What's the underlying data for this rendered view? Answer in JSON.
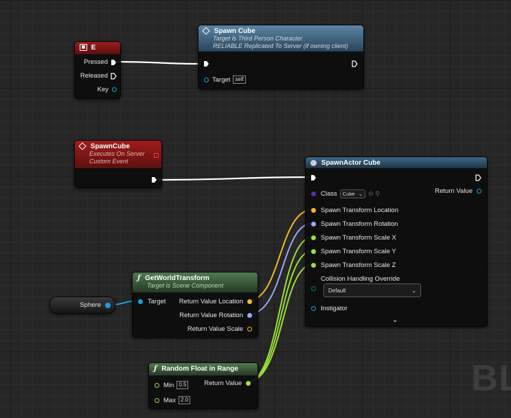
{
  "nodes": {
    "e_key": {
      "title": "E",
      "pressed": "Pressed",
      "released": "Released",
      "key": "Key"
    },
    "spawn_cube_call": {
      "title": "Spawn Cube",
      "subtitle1": "Target is Third Person Character",
      "subtitle2": "RELIABLE Replicated To Server (if owning client)",
      "target_label": "Target",
      "target_value": "self"
    },
    "spawn_cube_event": {
      "title": "SpawnCube",
      "subtitle1": "Executes On Server",
      "subtitle2": "Custom Event"
    },
    "spawn_actor": {
      "title": "SpawnActor Cube",
      "class_label": "Class",
      "class_value": "Cube",
      "return_value": "Return Value",
      "pins": [
        "Spawn Transform Location",
        "Spawn Transform Rotation",
        "Spawn Transform Scale X",
        "Spawn Transform Scale Y",
        "Spawn Transform Scale Z"
      ],
      "collision_label": "Collision Handling Override",
      "collision_value": "Default",
      "instigator": "Instigator"
    },
    "get_world_transform": {
      "title": "GetWorldTransform",
      "subtitle": "Target is Scene Component",
      "target": "Target",
      "outputs": [
        "Return Value Location",
        "Return Value Rotation",
        "Return Value Scale"
      ]
    },
    "sphere": {
      "label": "Sphere"
    },
    "random_float": {
      "title": "Random Float in Range",
      "min_label": "Min",
      "min_value": "0.5",
      "max_label": "Max",
      "max_value": "2.0",
      "return_value": "Return Value"
    }
  },
  "watermark": "BL",
  "colors": {
    "event_header": "#8b1818",
    "call_header": "#4a6f8a",
    "pure_header": "#3f5f3f",
    "pin_object": "#1aa0e0",
    "pin_vector": "#f7b927",
    "pin_rotator": "#9aa8ff",
    "pin_float": "#9ae23a",
    "pin_class": "#5a2fa8",
    "pin_enum": "#0f7a6a"
  }
}
